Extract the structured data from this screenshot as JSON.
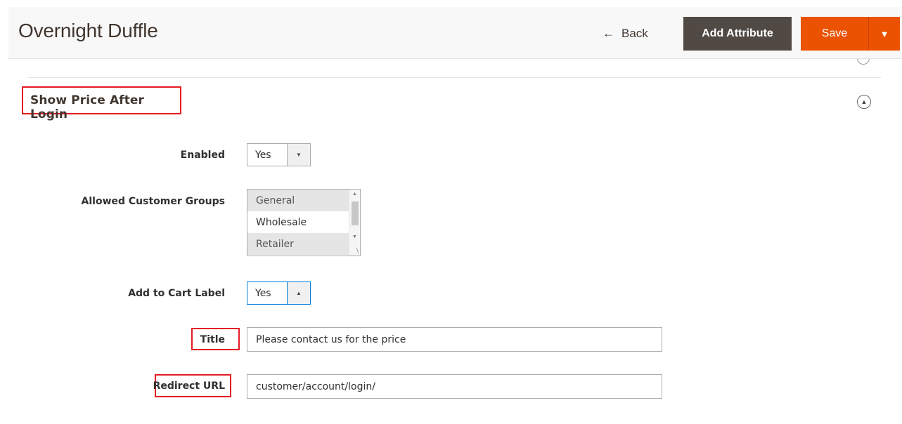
{
  "header": {
    "title": "Overnight Duffle",
    "back_label": "Back",
    "add_attribute_label": "Add Attribute",
    "save_label": "Save"
  },
  "section": {
    "title": "Show Price After Login"
  },
  "form": {
    "enabled": {
      "label": "Enabled",
      "value": "Yes"
    },
    "allowed_groups": {
      "label": "Allowed Customer Groups",
      "options": [
        {
          "label": "General",
          "selected": true
        },
        {
          "label": "Wholesale",
          "selected": false
        },
        {
          "label": "Retailer",
          "selected": true
        }
      ]
    },
    "add_to_cart_label": {
      "label": "Add to Cart Label",
      "value": "Yes"
    },
    "title": {
      "label": "Title",
      "value": "Please contact us for the price"
    },
    "redirect_url": {
      "label": "Redirect URL",
      "value": "customer/account/login/"
    }
  },
  "colors": {
    "accent": "#eb5202",
    "dark_button": "#514943",
    "highlight": "#e41c24"
  },
  "icons": [
    "left-arrow-icon",
    "caret-down-icon",
    "chevron-up-icon"
  ]
}
